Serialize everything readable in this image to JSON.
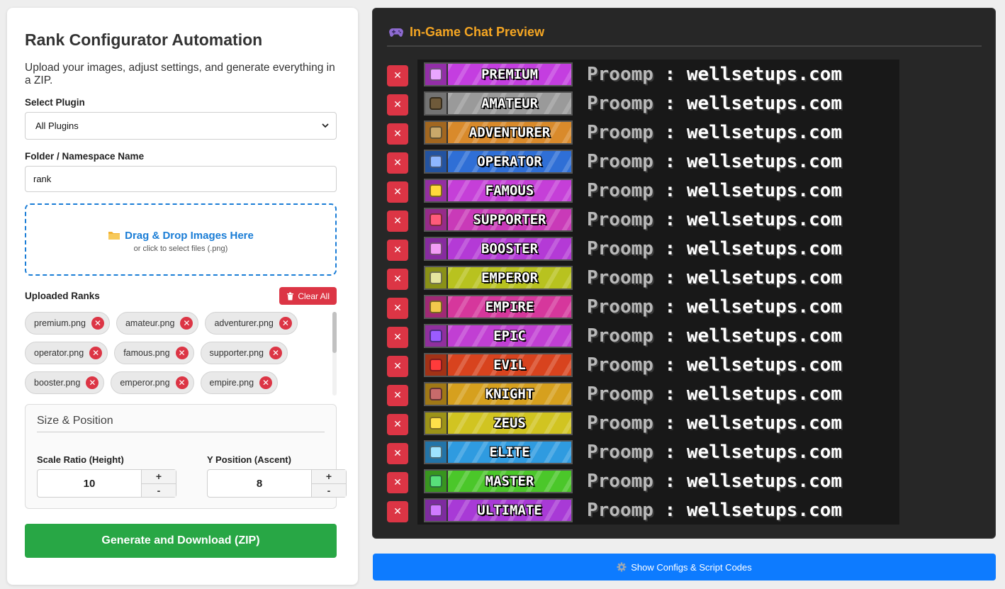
{
  "left": {
    "title": "Rank Configurator Automation",
    "description": "Upload your images, adjust settings, and generate everything in a ZIP.",
    "plugin_label": "Select Plugin",
    "plugin_selected": "All Plugins",
    "folder_label": "Folder / Namespace Name",
    "folder_value": "rank",
    "dropzone_title": "Drag & Drop Images Here",
    "dropzone_sub": "or click to select files (.png)",
    "uploaded_label": "Uploaded Ranks",
    "clear_all_label": "Clear All",
    "files": [
      "premium.png",
      "amateur.png",
      "adventurer.png",
      "operator.png",
      "famous.png",
      "supporter.png",
      "booster.png",
      "emperor.png",
      "empire.png"
    ],
    "settings_title": "Size & Position",
    "scale_label": "Scale Ratio (Height)",
    "scale_value": "10",
    "ypos_label": "Y Position (Ascent)",
    "ypos_value": "8",
    "plus": "+",
    "minus": "-",
    "generate_label": "Generate and Download (ZIP)"
  },
  "preview": {
    "title": "In-Game Chat Preview",
    "username": "Proomp",
    "separator": ":",
    "message": "wellsetups.com",
    "delete_glyph": "✕",
    "ranks": [
      {
        "name": "PREMIUM",
        "color": "#c43ee0",
        "icon": "#e8a6ff"
      },
      {
        "name": "AMATEUR",
        "color": "#9a9a9a",
        "icon": "#6f5a3a"
      },
      {
        "name": "ADVENTURER",
        "color": "#d98a2b",
        "icon": "#c9a86a"
      },
      {
        "name": "OPERATOR",
        "color": "#2f6fd6",
        "icon": "#8fb7ff"
      },
      {
        "name": "FAMOUS",
        "color": "#c53fd8",
        "icon": "#ffd93b"
      },
      {
        "name": "SUPPORTER",
        "color": "#c93ab8",
        "icon": "#ff5b7a"
      },
      {
        "name": "BOOSTER",
        "color": "#b43ad6",
        "icon": "#f29cf5"
      },
      {
        "name": "EMPEROR",
        "color": "#b8c21f",
        "icon": "#e6e6a0"
      },
      {
        "name": "EMPIRE",
        "color": "#d6379c",
        "icon": "#f2c94c"
      },
      {
        "name": "EPIC",
        "color": "#c13fd3",
        "icon": "#9b5cff"
      },
      {
        "name": "EVIL",
        "color": "#d8431e",
        "icon": "#ff3b3b"
      },
      {
        "name": "KNIGHT",
        "color": "#d6a01e",
        "icon": "#c76b6b"
      },
      {
        "name": "ZEUS",
        "color": "#d1c421",
        "icon": "#ffe14a"
      },
      {
        "name": "ELITE",
        "color": "#2f9be0",
        "icon": "#9fe3ff"
      },
      {
        "name": "MASTER",
        "color": "#4bc72a",
        "icon": "#58e07a"
      },
      {
        "name": "ULTIMATE",
        "color": "#a83ad6",
        "icon": "#d07bff"
      }
    ]
  },
  "show_configs_label": "Show Configs & Script Codes"
}
